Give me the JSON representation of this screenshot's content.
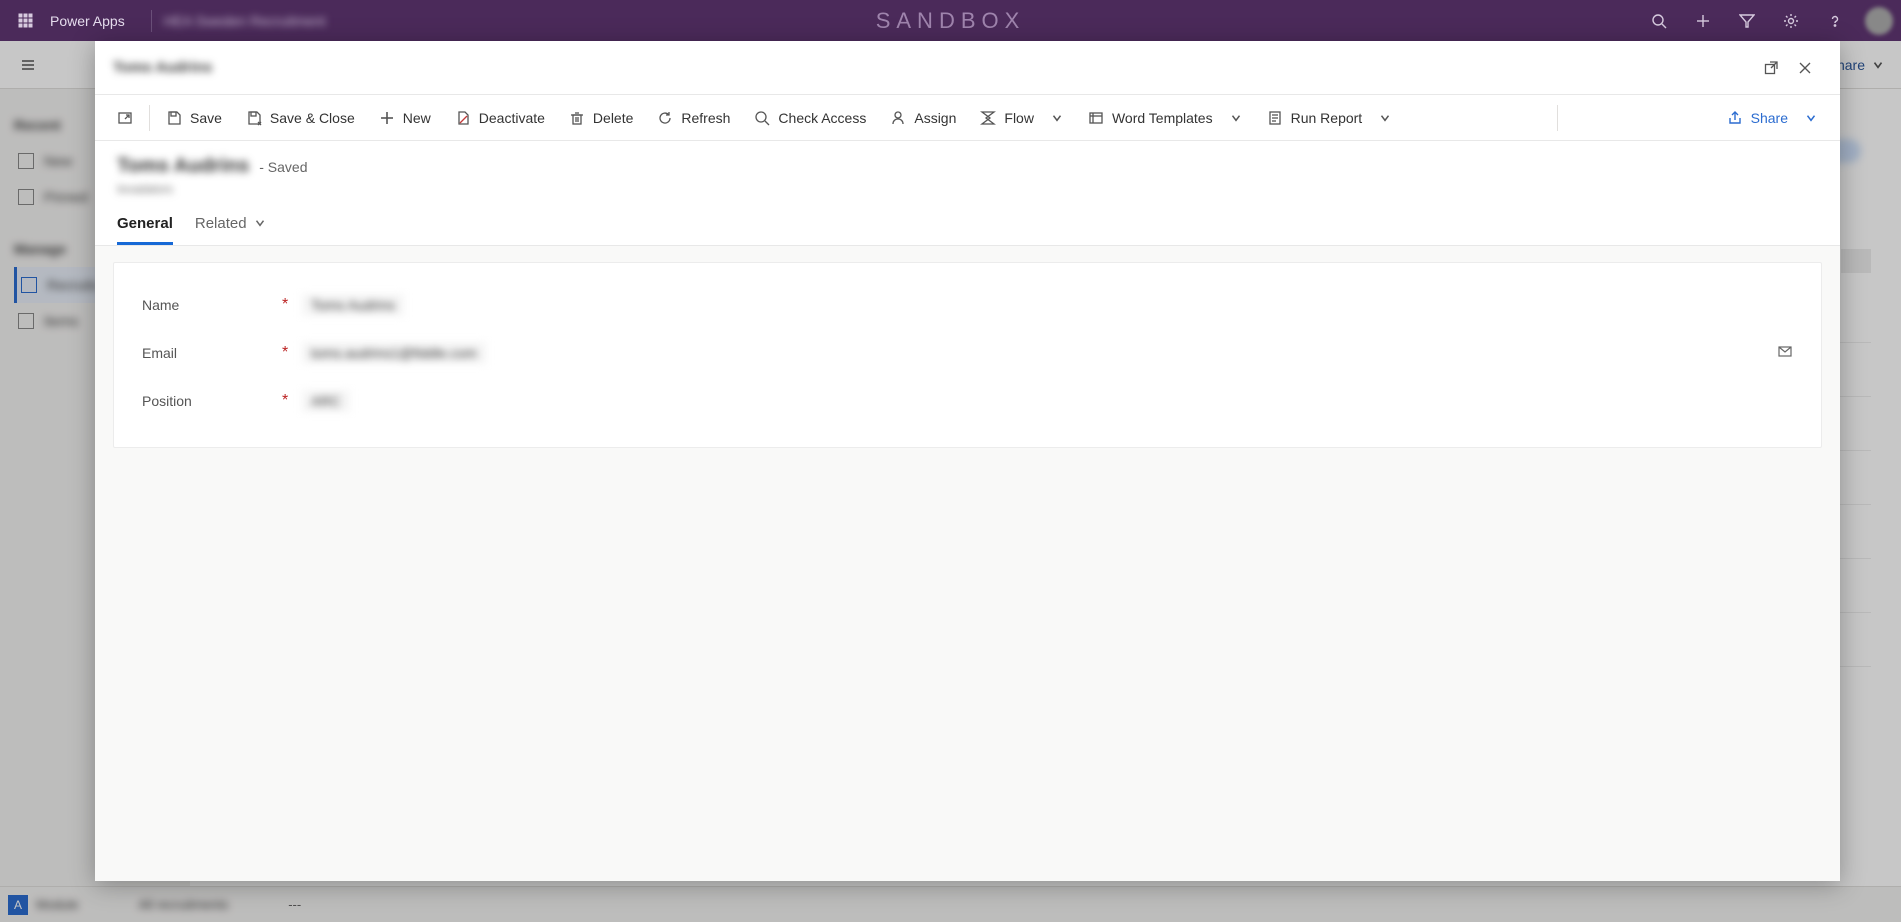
{
  "topbar": {
    "app_label": "Power Apps",
    "env_label": "HEA Sweden Recruitment",
    "center": "SANDBOX"
  },
  "bg": {
    "cmd_share": "Share",
    "sidebar_section_1": "Recent",
    "sidebar_item_1": "New",
    "sidebar_item_2": "Pinned",
    "sidebar_section_2": "Manage",
    "sidebar_item_3": "Recruits",
    "sidebar_item_4": "Items",
    "footer_chip": "A",
    "footer_text1": "Module",
    "footer_text2": "All recruitments",
    "footer_text3": "---"
  },
  "modal": {
    "title": "Toms Audrins",
    "cmd": {
      "save": "Save",
      "save_close": "Save & Close",
      "new": "New",
      "deactivate": "Deactivate",
      "delete": "Delete",
      "refresh": "Refresh",
      "check_access": "Check Access",
      "assign": "Assign",
      "flow": "Flow",
      "word_templates": "Word Templates",
      "run_report": "Run Report",
      "share": "Share"
    },
    "record": {
      "name": "Toms Audrins",
      "status": "- Saved",
      "subtitle": "Ievadators"
    },
    "tabs": {
      "general": "General",
      "related": "Related"
    },
    "fields": {
      "name_label": "Name",
      "name_value": "Toms Audrins",
      "email_label": "Email",
      "email_value": "toms.audrins1@fiddle.com",
      "position_label": "Position",
      "position_value": "ARC"
    }
  }
}
